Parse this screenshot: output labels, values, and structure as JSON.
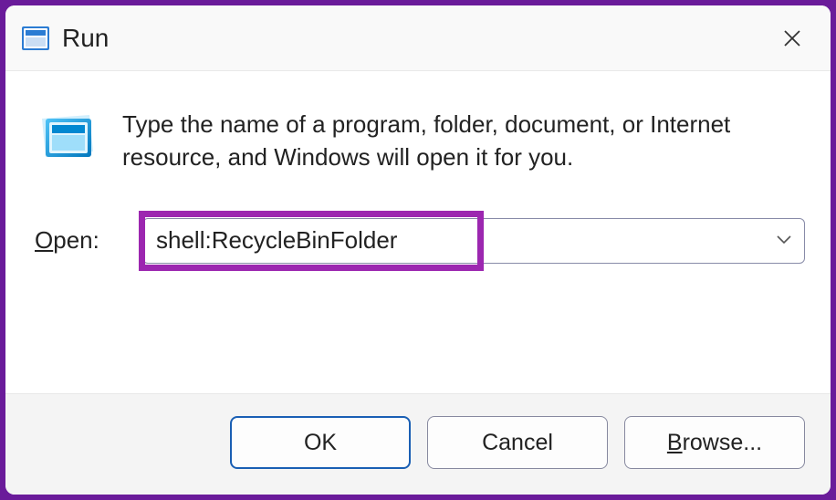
{
  "window": {
    "title": "Run"
  },
  "content": {
    "description": "Type the name of a program, folder, document, or Internet resource, and Windows will open it for you.",
    "open_label_prefix": "O",
    "open_label_rest": "pen:",
    "input_value": "shell:RecycleBinFolder"
  },
  "buttons": {
    "ok": "OK",
    "cancel": "Cancel",
    "browse_prefix": "B",
    "browse_rest": "rowse..."
  }
}
